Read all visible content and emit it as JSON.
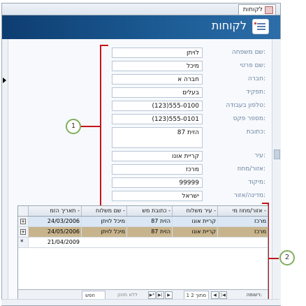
{
  "tab": {
    "label": "לקוחות"
  },
  "header": {
    "title": "לקוחות"
  },
  "colors": {
    "banner": "#1b5a93",
    "bracket": "#c4141b",
    "callout_ring": "#7fae5c",
    "label": "#6c83a2"
  },
  "fields": [
    {
      "label": "שם משפחה:",
      "value": "לויתן"
    },
    {
      "label": "שם פרטי:",
      "value": "מיכל"
    },
    {
      "label": "חברה:",
      "value": "חברה א"
    },
    {
      "label": "תפקיד:",
      "value": "בעלים"
    },
    {
      "label": "טלפון בעבודה:",
      "value": "(123)555-0100"
    },
    {
      "label": "מספר פקס:",
      "value": "(123)555-0101"
    },
    {
      "label": "כתובת:",
      "value": "87 הזית"
    },
    {
      "label": "עיר:",
      "value": "קריית אונו"
    },
    {
      "label": "אזור/מחוז:",
      "value": "מרכז"
    },
    {
      "label": "מיקוד:",
      "value": "99999"
    },
    {
      "label": "מדינה/אזור:",
      "value": "ישראל"
    }
  ],
  "callouts": [
    "1",
    "2"
  ],
  "grid": {
    "columns": [
      "אזור/מחוז מי -",
      "עיר משלוח -",
      "כתובת מש -",
      "שם משלוח -",
      "תאריך הזמ -"
    ],
    "rows": [
      {
        "cells": [
          "מרכז",
          "קריית אונו",
          "הזית 87",
          "מיכל לויתן",
          "24/03/2006"
        ],
        "expander": "+"
      },
      {
        "cells": [
          "מרכז",
          "קריית אונו",
          "הזית 87",
          "מיכל לויתן",
          "24/05/2006"
        ],
        "expander": "+"
      },
      {
        "cells": [
          "",
          "",
          "",
          "",
          "21/04/2009"
        ],
        "marker": "*"
      }
    ],
    "nav": {
      "record_label": "רשומה:",
      "position": "1 מתוך 2",
      "filter_label": "ללא מסנן",
      "search_label": "חפש"
    }
  }
}
